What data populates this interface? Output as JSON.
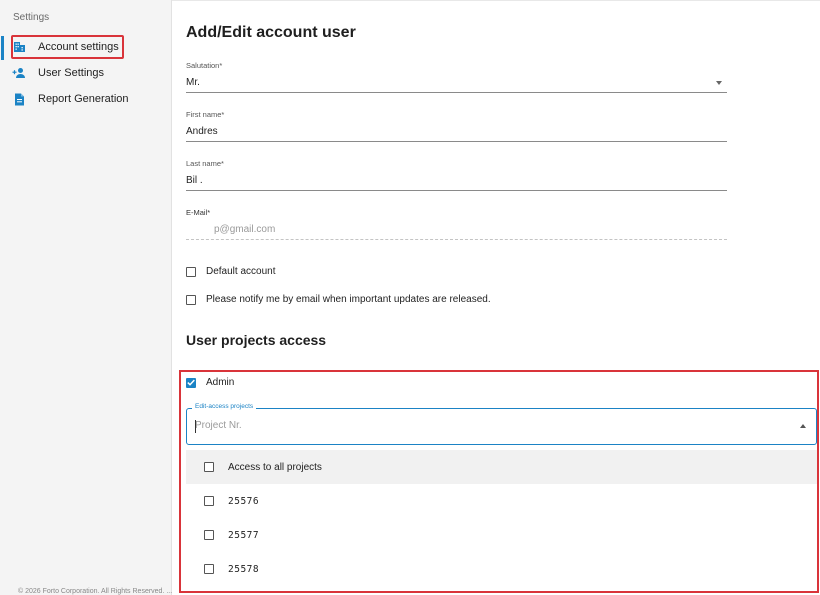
{
  "sidebar": {
    "header": "Settings",
    "items": [
      {
        "label": "Account settings",
        "icon": "building-icon",
        "active": true
      },
      {
        "label": "User Settings",
        "icon": "add-person-icon"
      },
      {
        "label": "Report Generation",
        "icon": "document-icon"
      }
    ],
    "footer": "© 2026 Forto Corporation. All Rights Reserved. ..."
  },
  "form": {
    "title": "Add/Edit account user",
    "salutation": {
      "label": "Salutation*",
      "value": "Mr."
    },
    "first_name": {
      "label": "First name*",
      "value": "Andres"
    },
    "last_name": {
      "label": "Last name*",
      "value": "Bil ."
    },
    "email": {
      "label": "E-Mail*",
      "value": "p@gmail.com"
    },
    "default_account": {
      "label": "Default account",
      "checked": false
    },
    "notify": {
      "label": "Please notify me by email when important updates are released.",
      "checked": false
    }
  },
  "projects": {
    "title": "User projects access",
    "admin": {
      "label": "Admin",
      "checked": true
    },
    "edit_access_label": "Edit-access projects",
    "placeholder": "Project Nr.",
    "options": [
      {
        "label": "Access to all projects",
        "checked": false
      },
      {
        "label": "25576",
        "checked": false
      },
      {
        "label": "25577",
        "checked": false
      },
      {
        "label": "25578",
        "checked": false
      }
    ]
  },
  "colors": {
    "accent": "#1b83c5",
    "highlight": "#d9343a",
    "sidebar_bg": "#f4f4f4"
  }
}
